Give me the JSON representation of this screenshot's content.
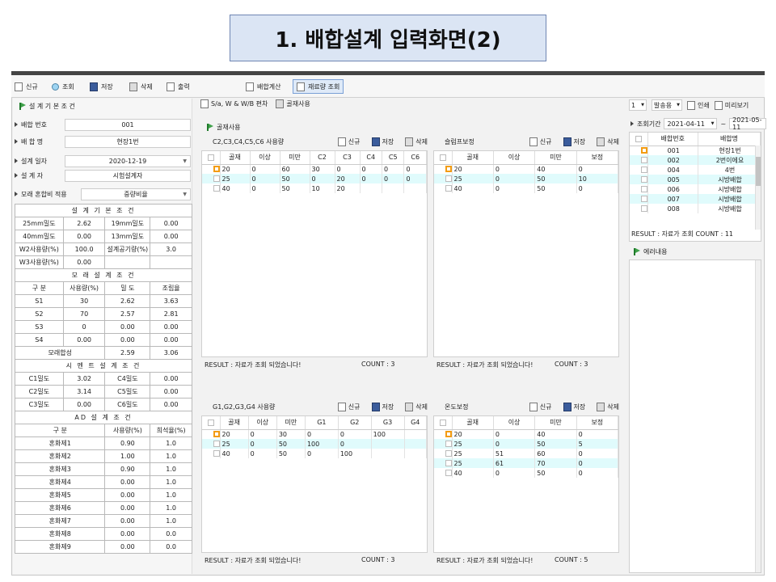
{
  "slide_title": "1. 배합설계 입력화면(2)",
  "toolbar": {
    "new": "신규",
    "search": "조회",
    "save": "저장",
    "delete": "삭제",
    "print": "출력",
    "calc": "배합계산",
    "material": "재료량 조회"
  },
  "left": {
    "section": "설 계 기 본 조 건",
    "fields": [
      {
        "label": "배합 번호",
        "value": "001"
      },
      {
        "label": "배 합 명",
        "value": "현장1번"
      },
      {
        "label": "설계 일자",
        "value": "2020-12-19"
      },
      {
        "label": "설 계 자",
        "value": "시험설계자"
      },
      {
        "label": "모래 혼합비 적용",
        "value": "중량비율"
      }
    ],
    "basic_title": "설 계 기 본 조 건",
    "basic_rows": [
      [
        "25mm밀도",
        "2.62",
        "19mm밀도",
        "0.00"
      ],
      [
        "40mm밀도",
        "0.00",
        "13mm밀도",
        "0.00"
      ],
      [
        "W2사용량(%)",
        "100.0",
        "설계공기량(%)",
        "3.0"
      ],
      [
        "W3사용량(%)",
        "0.00",
        "",
        ""
      ]
    ],
    "sand_title": "모 래 설 계 조 건",
    "sand_header": [
      "구 분",
      "사용량(%)",
      "밀 도",
      "조립율"
    ],
    "sand_rows": [
      [
        "S1",
        "30",
        "2.62",
        "3.63"
      ],
      [
        "S2",
        "70",
        "2.57",
        "2.81"
      ],
      [
        "S3",
        "0",
        "0.00",
        "0.00"
      ],
      [
        "S4",
        "0.00",
        "0.00",
        "0.00"
      ]
    ],
    "sand_total": [
      "모래합성",
      "2.59",
      "3.06"
    ],
    "cement_title": "시 멘 트 설 계 조 건",
    "cement_rows": [
      [
        "C1밀도",
        "3.02",
        "C4밀도",
        "0.00"
      ],
      [
        "C2밀도",
        "3.14",
        "C5밀도",
        "0.00"
      ],
      [
        "C3밀도",
        "0.00",
        "C6밀도",
        "0.00"
      ]
    ],
    "ad_title": "AD 설 계 조 건",
    "ad_header": [
      "구 분",
      "사용량(%)",
      "희석율(%)"
    ],
    "ad_rows": [
      [
        "혼화제1",
        "0.90",
        "1.0"
      ],
      [
        "혼화제2",
        "1.00",
        "1.0"
      ],
      [
        "혼화제3",
        "0.90",
        "1.0"
      ],
      [
        "혼화제4",
        "0.00",
        "1.0"
      ],
      [
        "혼화제5",
        "0.00",
        "1.0"
      ],
      [
        "혼화제6",
        "0.00",
        "1.0"
      ],
      [
        "혼화제7",
        "0.00",
        "1.0"
      ],
      [
        "혼화제8",
        "0.00",
        "0.0"
      ],
      [
        "혼화제9",
        "0.00",
        "0.0"
      ]
    ]
  },
  "middle": {
    "tabs": [
      "S/a, W  &  W/B 편차",
      "골재사용"
    ],
    "section": "골재사용",
    "btn_new": "신규",
    "btn_save": "저장",
    "btn_del": "삭제",
    "p1": {
      "title": "C2,C3,C4,C5,C6 사용량",
      "cols": [
        "골재",
        "이상",
        "미만",
        "C2",
        "C3",
        "C4",
        "C5",
        "C6"
      ],
      "rows": [
        [
          "20",
          "0",
          "60",
          "30",
          "0",
          "0",
          "0",
          "0"
        ],
        [
          "25",
          "0",
          "50",
          "0",
          "20",
          "0",
          "0",
          "0"
        ],
        [
          "40",
          "0",
          "50",
          "10",
          "20",
          "",
          "",
          ""
        ]
      ],
      "result": "RESULT :  자료가 조회 되었습니다!",
      "count": "COUNT :  3"
    },
    "p2": {
      "title": "슬럼프보정",
      "cols": [
        "골재",
        "이상",
        "미만",
        "보정"
      ],
      "rows": [
        [
          "20",
          "0",
          "40",
          "0"
        ],
        [
          "25",
          "0",
          "50",
          "10"
        ],
        [
          "40",
          "0",
          "50",
          "0"
        ]
      ],
      "result": "RESULT :  자료가 조회 되었습니다!",
      "count": "COUNT :  3"
    },
    "p3": {
      "title": "G1,G2,G3,G4 사용량",
      "cols": [
        "골재",
        "이상",
        "미만",
        "G1",
        "G2",
        "G3",
        "G4"
      ],
      "rows": [
        [
          "20",
          "0",
          "30",
          "0",
          "0",
          "100",
          ""
        ],
        [
          "25",
          "0",
          "50",
          "100",
          "0",
          "",
          ""
        ],
        [
          "40",
          "0",
          "50",
          "0",
          "100",
          "",
          ""
        ]
      ],
      "result": "RESULT :  자료가 조회 되었습니다!",
      "count": "COUNT :  3"
    },
    "p4": {
      "title": "온도보정",
      "cols": [
        "골재",
        "이상",
        "미만",
        "보정"
      ],
      "rows": [
        [
          "20",
          "0",
          "40",
          "0"
        ],
        [
          "25",
          "0",
          "50",
          "5"
        ],
        [
          "25",
          "51",
          "60",
          "0"
        ],
        [
          "25",
          "61",
          "70",
          "0"
        ],
        [
          "40",
          "0",
          "50",
          "0"
        ]
      ],
      "result": "RESULT :  자료가 조회 되었습니다!",
      "count": "COUNT :  5"
    }
  },
  "right": {
    "copies": "1",
    "mode": "발송용",
    "print": "인쇄",
    "preview": "미리보기",
    "period_label": "조회기간",
    "date_from": "2021-04-11",
    "tilde": "~",
    "date_to": "2021-05-11",
    "cols": [
      "배합번호",
      "배합명"
    ],
    "rows": [
      [
        "001",
        "현장1번"
      ],
      [
        "002",
        "2번이에요"
      ],
      [
        "004",
        "4번"
      ],
      [
        "005",
        "시방배합"
      ],
      [
        "006",
        "시방배합"
      ],
      [
        "007",
        "시방배합"
      ],
      [
        "008",
        "시방배합"
      ]
    ],
    "result": "RESULT :  자료가 조회 COUNT :  11",
    "error_label": "에러내용"
  }
}
